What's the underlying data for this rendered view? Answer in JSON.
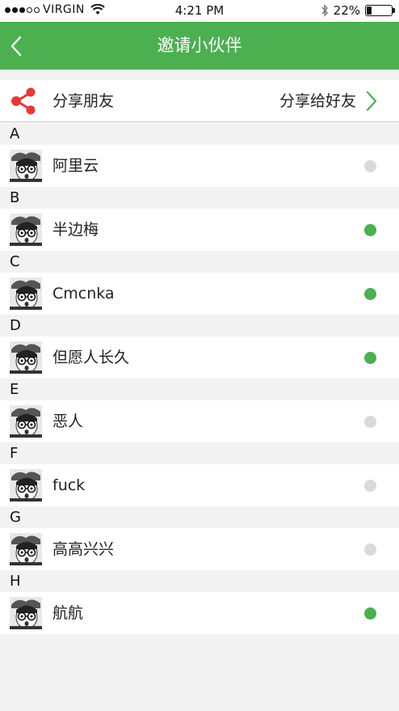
{
  "status": {
    "carrier": "VIRGIN",
    "time": "4:21 PM",
    "battery": "22%",
    "battery_level": 0.22,
    "signal_bars": 3
  },
  "nav": {
    "title": "邀请小伙伴"
  },
  "share": {
    "label": "分享朋友",
    "action": "分享给好友",
    "icon_color": "#e53935"
  },
  "colors": {
    "accent": "#4caf50",
    "inactive_dot": "#d9d9d9"
  },
  "sections": [
    {
      "letter": "A",
      "name": "阿里云",
      "active": false
    },
    {
      "letter": "B",
      "name": "半边梅",
      "active": true
    },
    {
      "letter": "C",
      "name": "Cmcnka",
      "active": true
    },
    {
      "letter": "D",
      "name": "但愿人长久",
      "active": true
    },
    {
      "letter": "E",
      "name": "恶人",
      "active": false
    },
    {
      "letter": "F",
      "name": "fuck",
      "active": false
    },
    {
      "letter": "G",
      "name": "高高兴兴",
      "active": false
    },
    {
      "letter": "H",
      "name": "航航",
      "active": true
    }
  ]
}
